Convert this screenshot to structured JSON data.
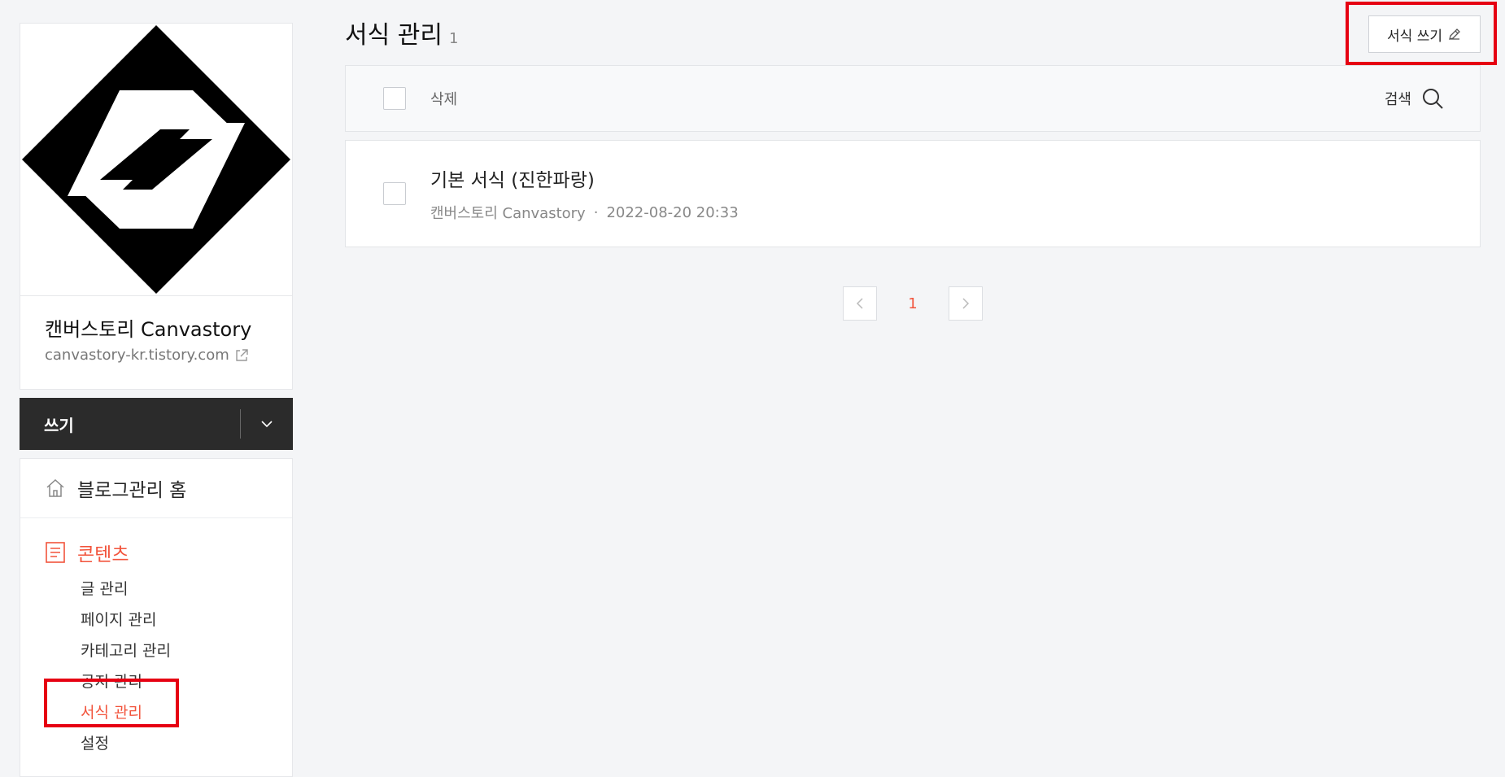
{
  "blog": {
    "name": "캔버스토리 Canvastory",
    "url": "canvastory-kr.tistory.com"
  },
  "write": {
    "label": "쓰기"
  },
  "nav": {
    "home_label": "블로그관리 홈",
    "section_label": "콘텐츠",
    "items": [
      {
        "label": "글 관리"
      },
      {
        "label": "페이지 관리"
      },
      {
        "label": "카테고리 관리"
      },
      {
        "label": "공지 관리"
      },
      {
        "label": "서식 관리"
      },
      {
        "label": "설정"
      }
    ]
  },
  "page": {
    "title": "서식 관리",
    "count": "1",
    "new_button": "서식 쓰기"
  },
  "toolbar": {
    "delete_label": "삭제",
    "search_label": "검색"
  },
  "list": [
    {
      "title": "기본 서식 (진한파랑)",
      "author": "캔버스토리 Canvastory",
      "date": "2022-08-20 20:33"
    }
  ],
  "pager": {
    "current": "1"
  },
  "colors": {
    "accent": "#f2543c",
    "highlight": "#e60012",
    "dark": "#2b2b2b"
  }
}
